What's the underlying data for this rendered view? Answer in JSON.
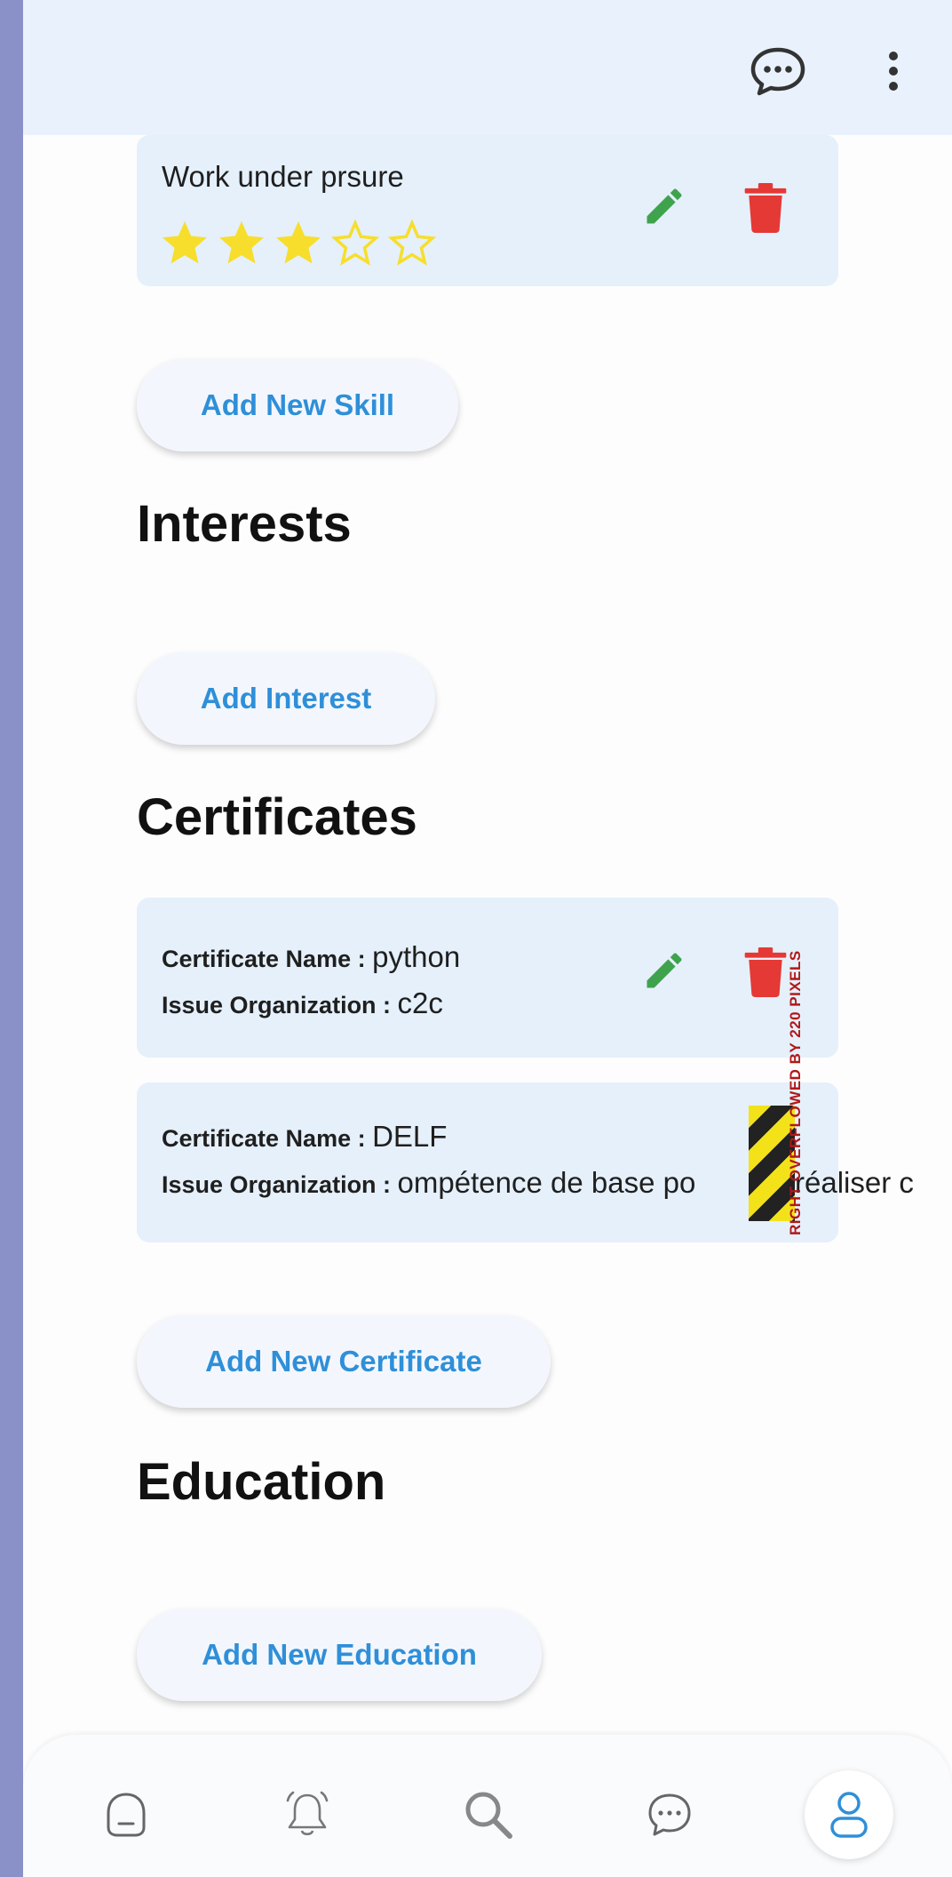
{
  "skill": {
    "name": "Work under prsure",
    "rating": 3,
    "max_rating": 5
  },
  "buttons": {
    "add_skill": "Add New Skill",
    "add_interest": "Add Interest",
    "add_certificate": "Add New Certificate",
    "add_education": "Add New Education"
  },
  "headings": {
    "interests": "Interests",
    "certificates": "Certificates",
    "education": "Education"
  },
  "certificates": [
    {
      "name_label": "Certificate Name : ",
      "name": "python",
      "org_label": "Issue Organization : ",
      "org": "c2c"
    },
    {
      "name_label": "Certificate Name : ",
      "name": "DELF",
      "org_label": "Issue Organization : ",
      "org": "ompétence de base po",
      "org_tail": "réaliser c"
    }
  ],
  "overflow_warning": "RIGHT OVERFLOWED BY 220 PIXELS",
  "colors": {
    "accent": "#2f8fd8",
    "edit": "#3fa34d",
    "delete": "#e53935",
    "star": "#f7de2c",
    "card": "#e5f0fb",
    "appbar": "#e9f2fc"
  },
  "icons": {
    "appbar": [
      "chat-bubble-icon",
      "more-vert-icon"
    ],
    "card_actions": [
      "pencil-icon",
      "trash-icon"
    ],
    "nav": [
      "home-icon",
      "bell-icon",
      "search-icon",
      "chat-icon",
      "profile-icon"
    ]
  }
}
